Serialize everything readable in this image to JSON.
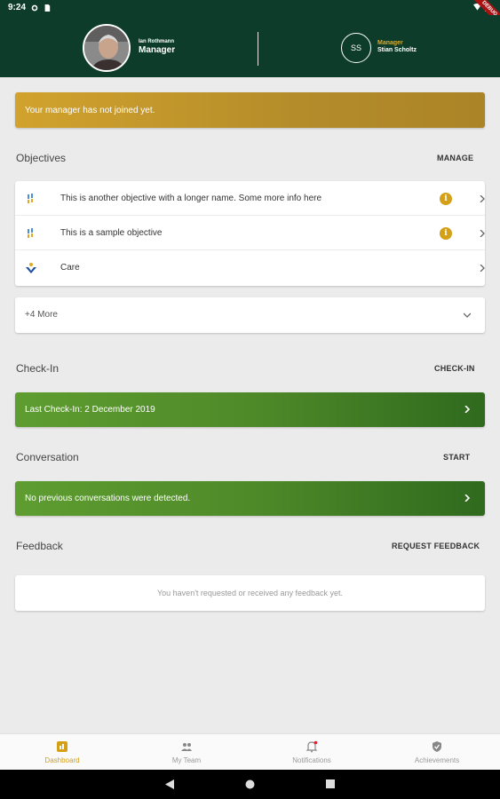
{
  "status_bar": {
    "time": "9:24",
    "ribbon": "DEBUG"
  },
  "header": {
    "user_name": "Ian Rothmann",
    "user_role": "Manager",
    "manager_initials": "SS",
    "manager_role": "Manager",
    "manager_name": "Stian Scholtz"
  },
  "banner": {
    "text": "Your manager has not joined yet."
  },
  "objectives": {
    "title": "Objectives",
    "action": "MANAGE",
    "items": [
      {
        "label": "This is another objective with a longer name. Some more info here",
        "has_info": true,
        "icon": "objective-icon"
      },
      {
        "label": "This is a sample objective",
        "has_info": true,
        "icon": "objective-icon"
      },
      {
        "label": "Care",
        "has_info": false,
        "icon": "care-icon"
      }
    ],
    "more_label": "+4 More"
  },
  "checkin": {
    "title": "Check-In",
    "action": "CHECK-IN",
    "bar_text": "Last Check-In: 2 December 2019"
  },
  "conversation": {
    "title": "Conversation",
    "action": "START",
    "bar_text": "No previous conversations were detected."
  },
  "feedback": {
    "title": "Feedback",
    "action": "REQUEST FEEDBACK",
    "empty_text": "You haven't requested or received any feedback yet."
  },
  "bottom_nav": {
    "items": [
      {
        "label": "Dashboard",
        "icon": "dashboard-icon",
        "active": true
      },
      {
        "label": "My Team",
        "icon": "team-icon",
        "active": false
      },
      {
        "label": "Notifications",
        "icon": "bell-icon",
        "active": false
      },
      {
        "label": "Achievements",
        "icon": "shield-check-icon",
        "active": false
      }
    ]
  },
  "colors": {
    "header_bg": "#0d3d2a",
    "accent_gold": "#d4a017",
    "green_bar": "#4f8a29",
    "warn_bar": "#c49a2c"
  }
}
